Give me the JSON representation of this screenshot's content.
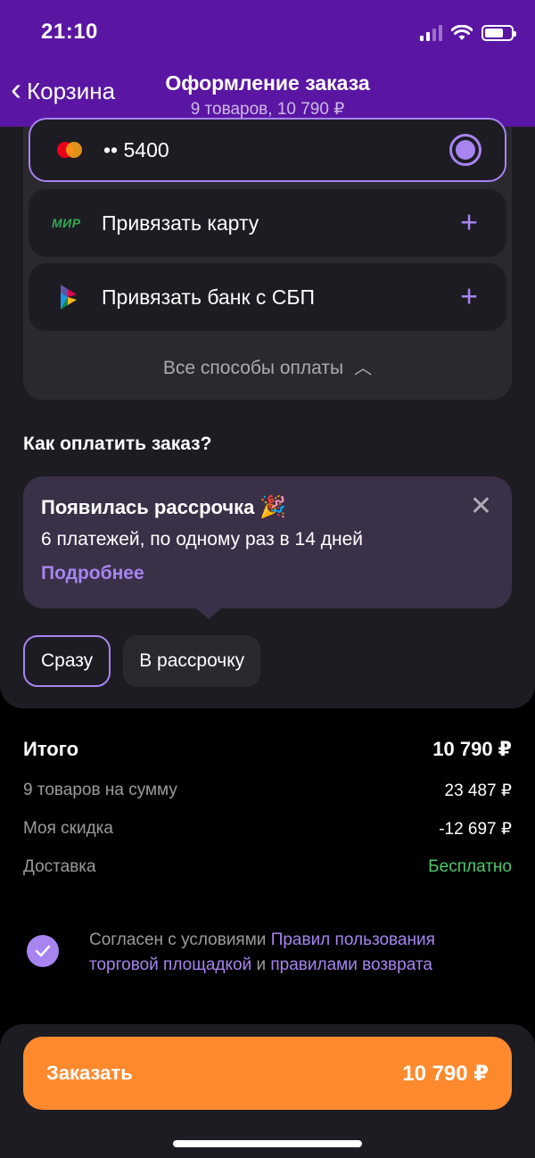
{
  "status_bar": {
    "time": "21:10"
  },
  "header": {
    "back_label": "Корзина",
    "title": "Оформление заказа",
    "subtitle": "9 товаров, 10 790 ₽"
  },
  "payment_methods": {
    "selected_card": {
      "masked": "•• 5400",
      "icon": "mastercard-icon"
    },
    "items": [
      {
        "label": "Привязать карту",
        "icon": "mir-logo-icon",
        "logo_text": "МИР"
      },
      {
        "label": "Привязать банк с СБП",
        "icon": "sbp-logo-icon"
      }
    ],
    "all_methods_label": "Все способы оплаты"
  },
  "how_to_pay": {
    "title": "Как оплатить заказ?",
    "promo": {
      "title": "Появилась рассрочка",
      "emoji": "🎉",
      "description": "6 платежей, по одному раз в 14 дней",
      "link": "Подробнее"
    },
    "options": [
      {
        "label": "Сразу",
        "selected": true
      },
      {
        "label": "В рассрочку",
        "selected": false
      }
    ]
  },
  "totals": {
    "total_label": "Итого",
    "total_value": "10 790 ₽",
    "lines": [
      {
        "label": "9 товаров на сумму",
        "value": "23 487 ₽"
      },
      {
        "label": "Моя скидка",
        "value": "-12 697 ₽"
      },
      {
        "label": "Доставка",
        "value": "Бесплатно"
      }
    ]
  },
  "agreement": {
    "checked": true,
    "text_prefix": "Согласен с условиями ",
    "link1": "Правил пользования торговой площадкой",
    "text_mid": " и ",
    "link2": "правилами возврата"
  },
  "order_button": {
    "label": "Заказать",
    "amount": "10 790 ₽"
  },
  "colors": {
    "header_bg": "#5a16a3",
    "accent": "#a784f0",
    "order_button": "#ff8a2e",
    "free_delivery": "#4cc76d"
  }
}
